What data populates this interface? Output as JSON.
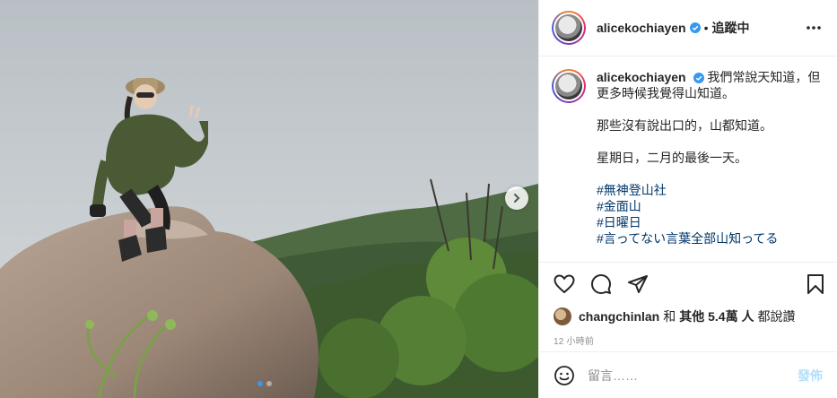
{
  "post": {
    "username": "alicekochiayen",
    "follow_status": "追蹤中",
    "separator": "•"
  },
  "caption": {
    "username": "alicekochiayen",
    "line1": "我們常說天知道，但更多時候我覺得山知道。",
    "line2": "那些沒有說出口的，山都知道。",
    "line3": "星期日，二月的最後一天。",
    "hashtags": [
      "#無神登山社",
      "#金面山",
      "#日曜日",
      "#言ってない言葉全部山知ってる"
    ]
  },
  "likes": {
    "user": "changchinlan",
    "and": "和",
    "others": "其他 5.4萬 人",
    "suffix": "都說讚"
  },
  "time": "12 小時前",
  "comment": {
    "placeholder": "留言……",
    "post_label": "發佈"
  },
  "carousel": {
    "current": 1,
    "total": 2
  },
  "icons": [
    "verified-badge-icon",
    "more-options-icon",
    "heart-icon",
    "comment-icon",
    "share-icon",
    "bookmark-icon",
    "emoji-icon",
    "next-arrow-icon"
  ],
  "colors": {
    "accent": "#0095f6",
    "hashtag": "#00376b",
    "muted": "#8e8e8e",
    "post_disabled": "#b2dffc"
  }
}
